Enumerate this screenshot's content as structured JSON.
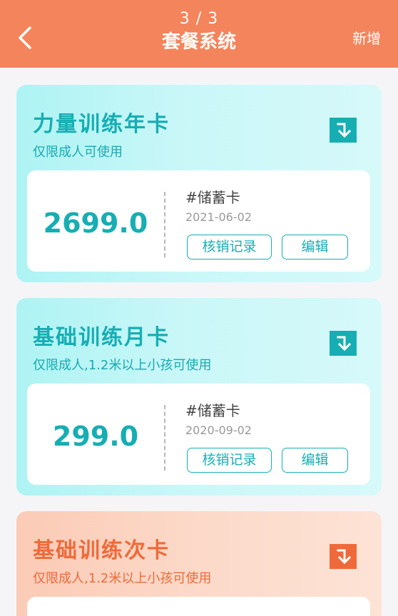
{
  "header": {
    "page_indicator": "3 / 3",
    "title": "套餐系统",
    "add_label": "新增",
    "back_icon": "chevron-left-icon"
  },
  "colors": {
    "header": "#f4845b",
    "accent_cyan": "#17aeb3",
    "accent_orange": "#ef6a3a"
  },
  "cards": [
    {
      "title": "力量训练年卡",
      "subtitle": "仅限成人可使用",
      "price": "2699.0",
      "tag": "#储蓄卡",
      "date": "2021-06-02",
      "records_label": "核销记录",
      "edit_label": "编辑",
      "icon": "download-arrow-icon"
    },
    {
      "title": "基础训练月卡",
      "subtitle": "仅限成人,1.2米以上小孩可使用",
      "price": "299.0",
      "tag": "#储蓄卡",
      "date": "2020-09-02",
      "records_label": "核销记录",
      "edit_label": "编辑",
      "icon": "download-arrow-icon"
    },
    {
      "title": "基础训练次卡",
      "subtitle": "仅限成人,1.2米以上小孩可使用",
      "icon": "download-arrow-icon"
    }
  ]
}
